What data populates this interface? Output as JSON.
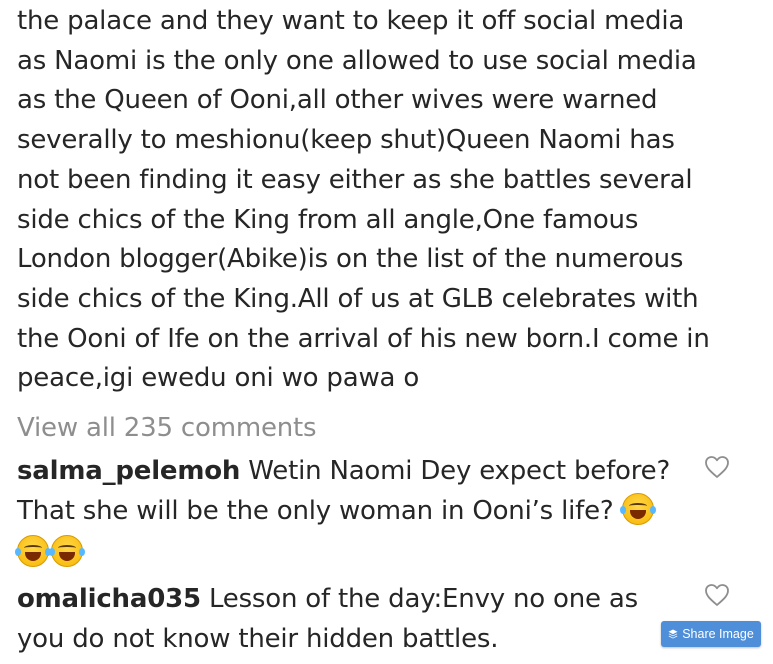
{
  "post": {
    "caption": "the palace and they want to keep it off social media\nas Naomi is the only one allowed to use social media\nas the Queen of Ooni,all other wives were warned\nseverally to meshionu(keep shut)Queen Naomi has\nnot been finding it easy either as she battles several\nside chics of the King from all angle,One famous\nLondon blogger(Abike)is on the list of the numerous\nside chics of the King.All of us at GLB celebrates with\nthe Ooni of Ife on the arrival of his new born.I come in\npeace,igi ewedu oni wo pawa o",
    "view_all_comments": "View all 235 comments"
  },
  "comments": [
    {
      "username": "salma_pelemoh",
      "text": " Wetin Naomi Dey expect before?\nThat she will be the only woman in Ooni’s life? ",
      "trailing_emoji": "grinning-squinting-face-emoji",
      "extra_emoji_count": 2
    },
    {
      "username": "omalicha035",
      "text": " Lesson of the day:Envy no one as\nyou do not know their hidden battles."
    }
  ],
  "share": {
    "label": "Share Image",
    "color": "#4f8ed8"
  },
  "colors": {
    "text": "#262626",
    "muted": "#8e8e8e"
  }
}
